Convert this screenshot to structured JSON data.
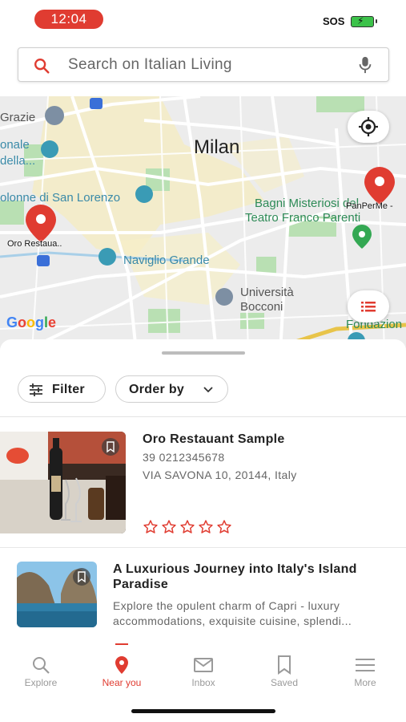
{
  "status_bar": {
    "time": "12:04",
    "sos": "SOS"
  },
  "search": {
    "placeholder": "Search on Italian Living"
  },
  "map": {
    "city": "Milan",
    "labels": {
      "grazie": "Grazie",
      "onale": "onale",
      "della": "della...",
      "san_lorenzo": "olonne di San Lorenzo",
      "bagni": "Bagni Misteriosi del",
      "teatro": "Teatro Franco Parenti",
      "panperme": "PanPerMe -",
      "oro_restaurant": "Oro Restaua..",
      "naviglio": "Naviglio Grande",
      "universita": "Università",
      "bocconi": "Bocconi",
      "fondazion": "Fondazion",
      "google": "Google"
    }
  },
  "sheet": {
    "filter_label": "Filter",
    "order_label": "Order by",
    "items": [
      {
        "title": "Oro Restauant Sample",
        "phone": "39 0212345678",
        "address": "VIA SAVONA 10, 20144, Italy",
        "rating": 0,
        "max_rating": 5
      },
      {
        "title": "A Luxurious Journey into Italy's Island Paradise",
        "description": "Explore the opulent charm of Capri - luxury accommodations, exquisite cuisine, splendi..."
      }
    ]
  },
  "bottom_nav": {
    "items": [
      {
        "label": "Explore",
        "icon": "search-icon"
      },
      {
        "label": "Near you",
        "icon": "location-pin-icon",
        "active": true
      },
      {
        "label": "Inbox",
        "icon": "mail-icon"
      },
      {
        "label": "Saved",
        "icon": "bookmark-icon"
      },
      {
        "label": "More",
        "icon": "menu-icon"
      }
    ]
  },
  "colors": {
    "accent": "#e03c31",
    "inactive": "#9a9a9a",
    "map_bg": "#ececec"
  }
}
